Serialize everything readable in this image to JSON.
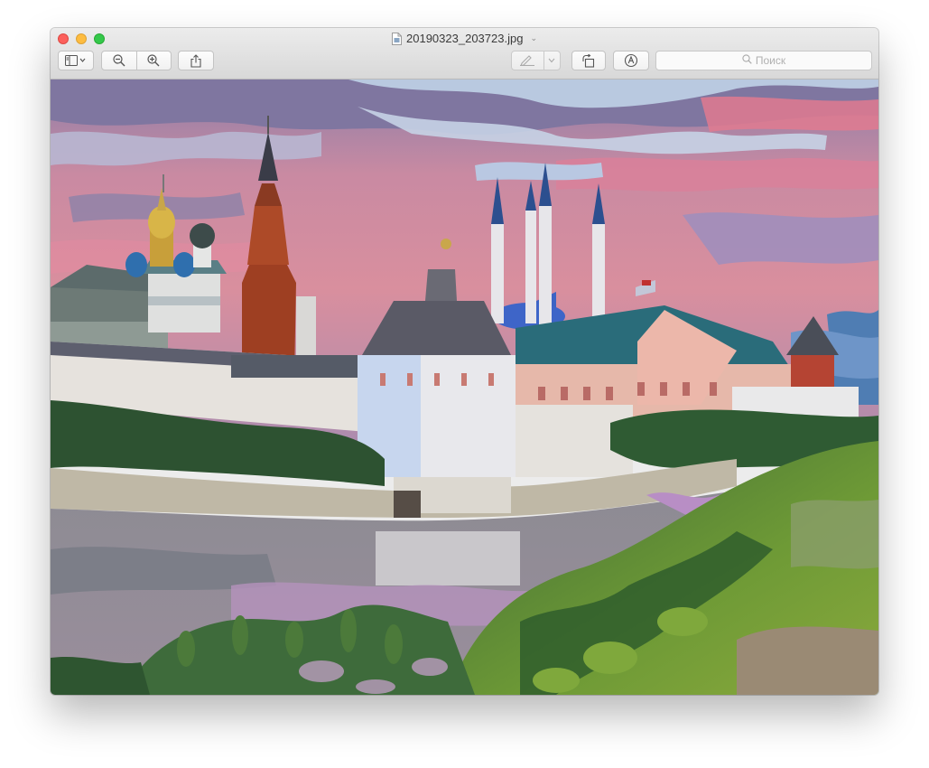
{
  "window": {
    "title": "20190323_203723.jpg"
  },
  "toolbar": {
    "sidebar_icon": "sidebar-toggle-icon",
    "zoom_out_icon": "zoom-out-icon",
    "zoom_in_icon": "zoom-in-icon",
    "share_icon": "share-icon",
    "markup_pen_icon": "highlighter-pen-icon",
    "rotate_icon": "rotate-icon",
    "annotate_icon": "markup-icon"
  },
  "search": {
    "placeholder": "Поиск"
  },
  "image": {
    "subject": "oil-painting-kremlin-landscape"
  },
  "colors": {
    "close": "#fc605c",
    "minimize": "#fdbc40",
    "zoom": "#34c84a"
  }
}
